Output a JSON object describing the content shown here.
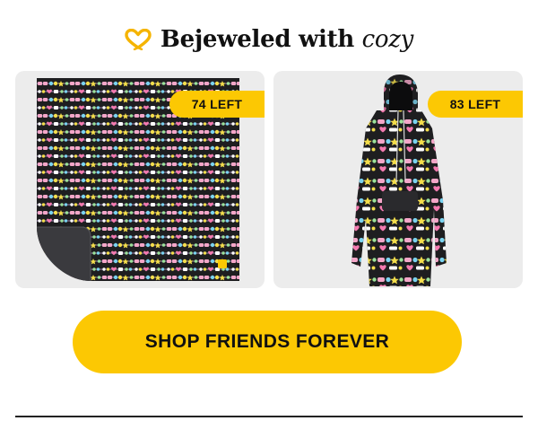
{
  "header": {
    "icon": "heart-hands-icon",
    "title_main": "Bejeweled with ",
    "title_accent": "cozy"
  },
  "products": [
    {
      "name": "blanket",
      "image": "friendship-bracelet-print-blanket",
      "badge": "74 LEFT"
    },
    {
      "name": "hoodie",
      "image": "friendship-bracelet-print-wearable-blanket-hoodie",
      "badge": "83 LEFT"
    }
  ],
  "cta": {
    "label": "SHOP FRIENDS FOREVER"
  },
  "colors": {
    "accent_yellow": "#fcc803",
    "card_gray": "#ececec",
    "text_dark": "#111111",
    "print_black": "#1e1e20"
  }
}
